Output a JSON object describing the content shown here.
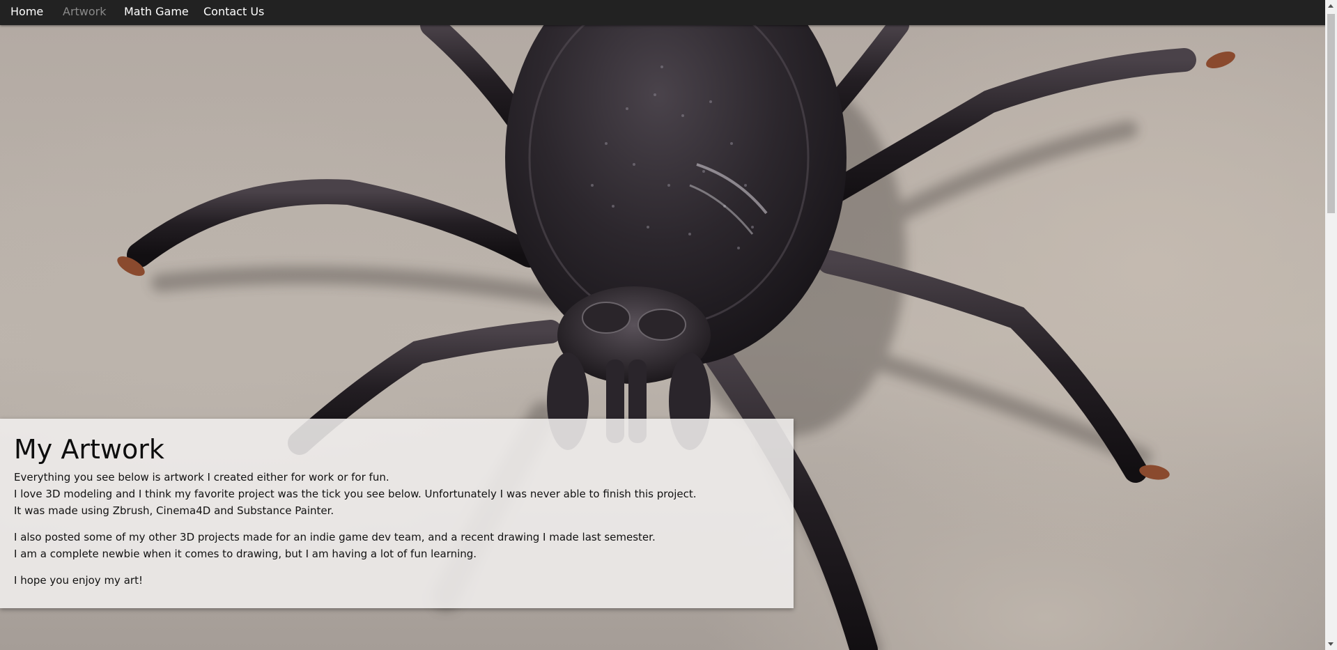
{
  "nav": {
    "items": [
      {
        "label": "Home",
        "active": false
      },
      {
        "label": "Artwork",
        "active": true
      },
      {
        "label": "Math Game",
        "active": false
      },
      {
        "label": "Contact Us",
        "active": false
      }
    ]
  },
  "hero": {
    "image_subject": "3D tick model rendered on grey surface"
  },
  "panel": {
    "title": "My Artwork",
    "paragraphs": [
      [
        "Everything you see below is artwork I created either for work or for fun.",
        "I love 3D modeling and I think my favorite project was the tick you see below. Unfortunately I was never able to finish this project.",
        "It was made using Zbrush, Cinema4D and Substance Painter."
      ],
      [
        "I also posted some of my other 3D projects made for an indie game dev team, and a recent drawing I made last semester.",
        "I am a complete newbie when it comes to drawing, but I am having a lot of fun learning."
      ],
      [
        "I hope you enjoy my art!"
      ]
    ]
  },
  "colors": {
    "navbar_bg": "#222222",
    "nav_text": "#ffffff",
    "nav_active": "#8a8a8a",
    "panel_bg": "#f0eeed"
  }
}
